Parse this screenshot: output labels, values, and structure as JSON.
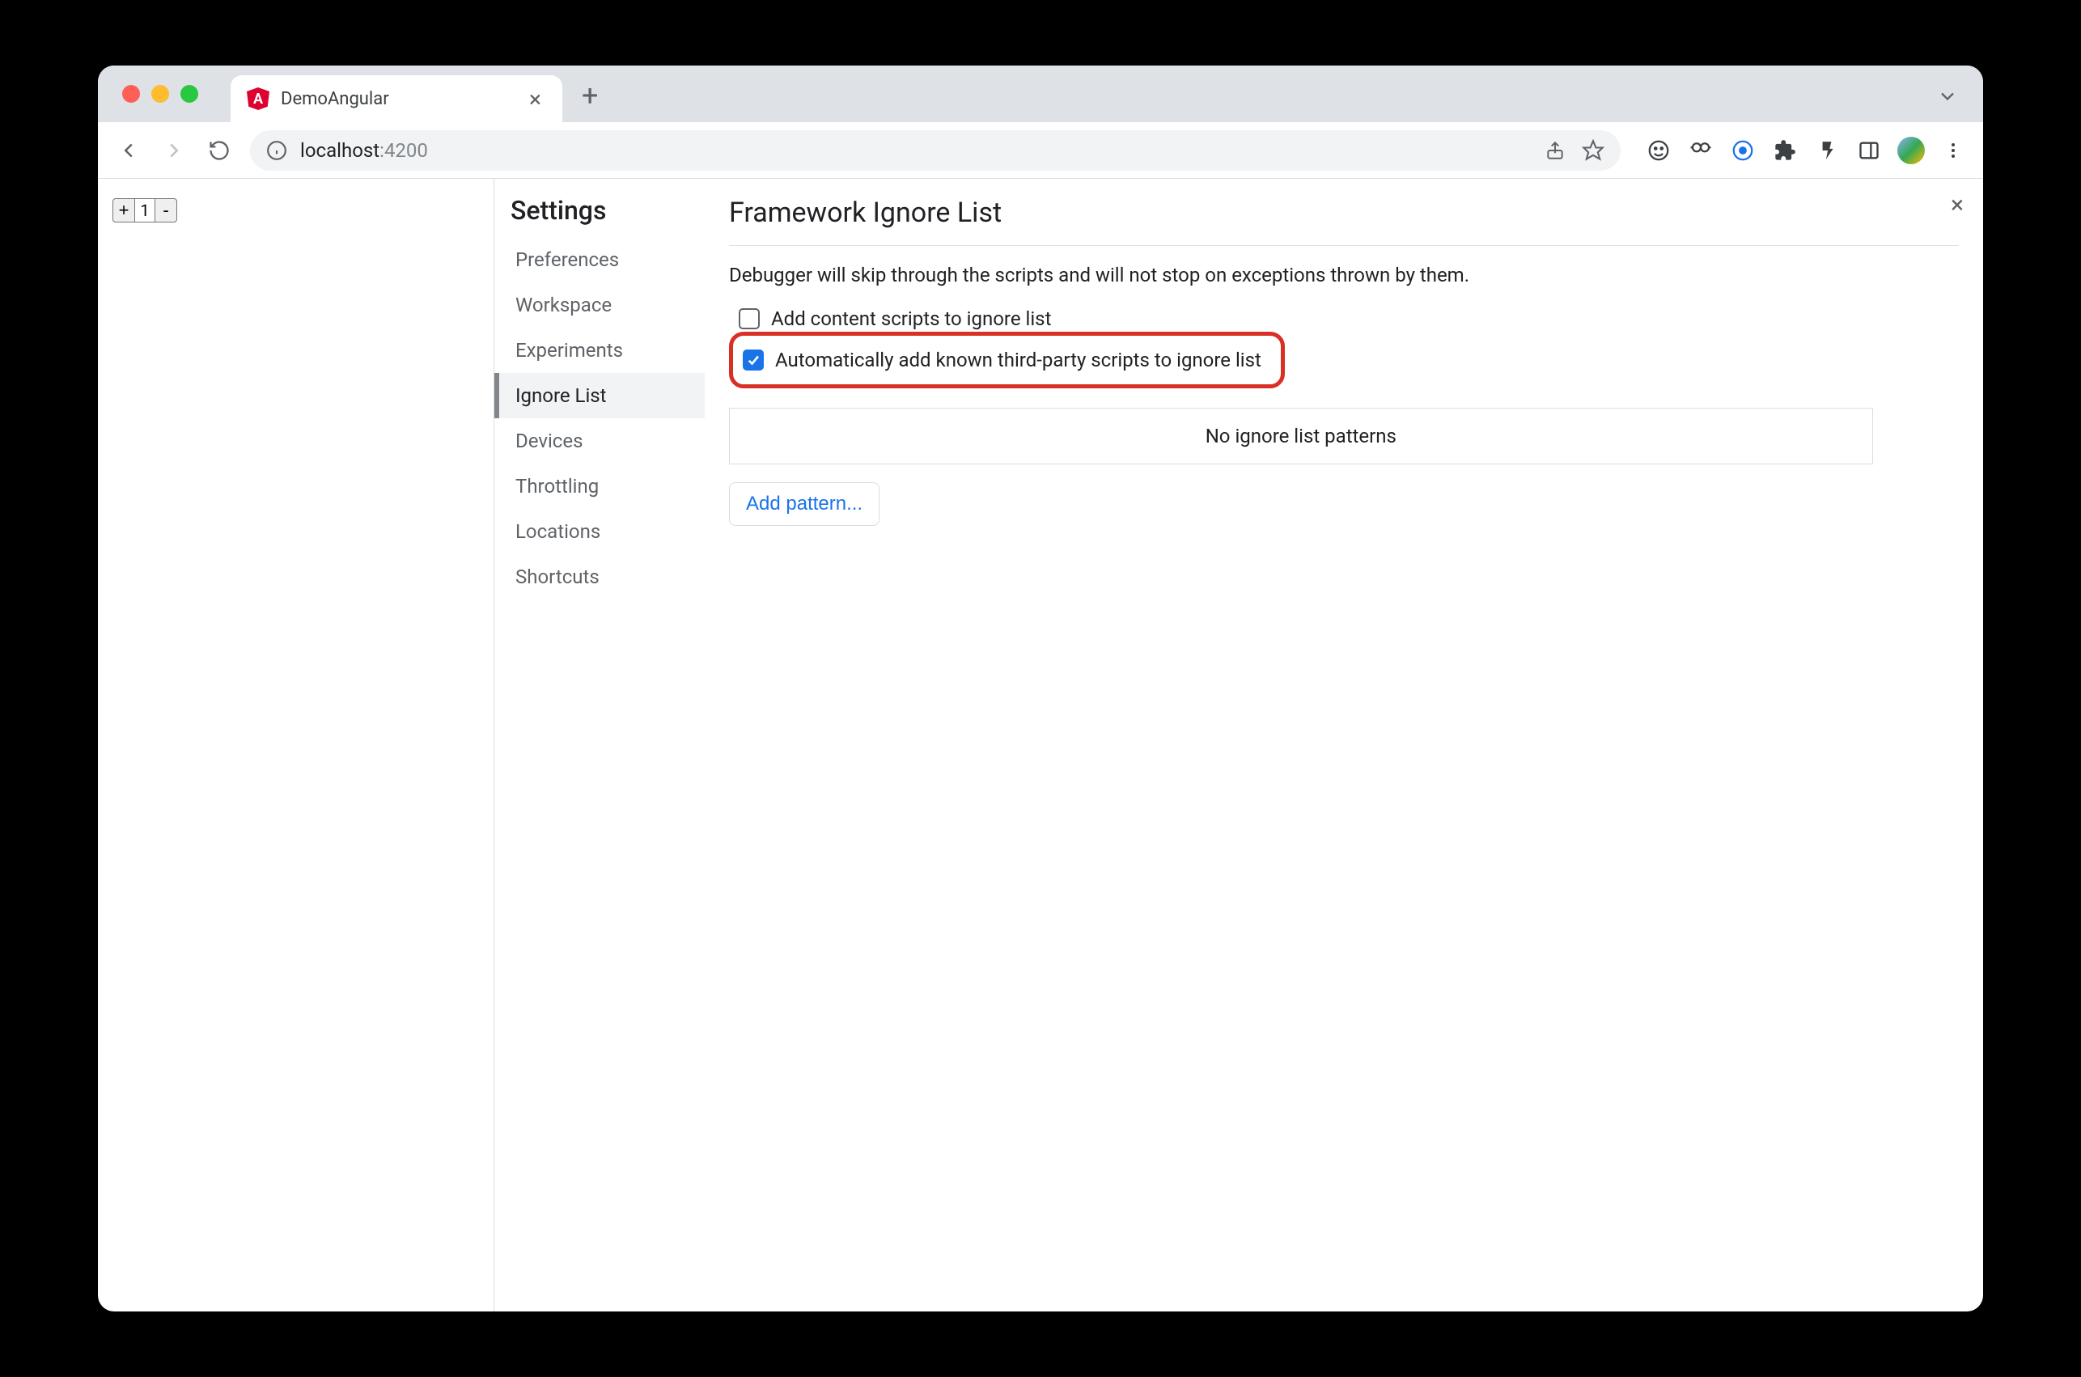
{
  "browser": {
    "tab_title": "DemoAngular",
    "url_host": "localhost",
    "url_port": ":4200"
  },
  "page": {
    "counter": {
      "plus": "+",
      "value": "1",
      "minus": "-"
    }
  },
  "devtools": {
    "settings_title": "Settings",
    "nav": {
      "preferences": "Preferences",
      "workspace": "Workspace",
      "experiments": "Experiments",
      "ignore_list": "Ignore List",
      "devices": "Devices",
      "throttling": "Throttling",
      "locations": "Locations",
      "shortcuts": "Shortcuts"
    },
    "panel": {
      "title": "Framework Ignore List",
      "description": "Debugger will skip through the scripts and will not stop on exceptions thrown by them.",
      "checkbox_content_scripts": "Add content scripts to ignore list",
      "checkbox_third_party": "Automatically add known third-party scripts to ignore list",
      "empty_patterns": "No ignore list patterns",
      "add_pattern": "Add pattern..."
    }
  }
}
